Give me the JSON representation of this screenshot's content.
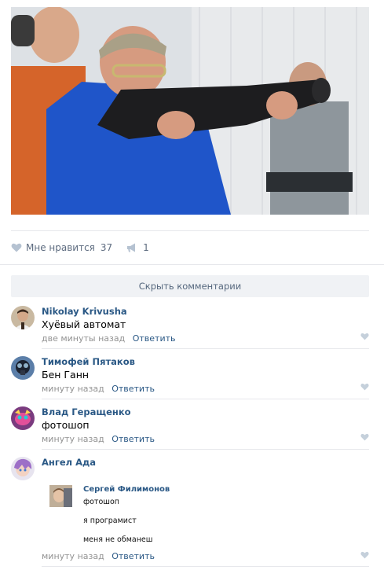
{
  "post": {
    "likes_label": "Мне нравится",
    "likes_count": "37",
    "reposts_count": "1",
    "hide_comments_label": "Скрыть комментарии"
  },
  "comments": [
    {
      "author": "Nikolay Krivusha",
      "text": "Хуёвый автомат",
      "time": "две минуты назад",
      "reply": "Ответить"
    },
    {
      "author": "Тимофей Пятаков",
      "text": "Бен Ганн",
      "time": "минуту назад",
      "reply": "Ответить"
    },
    {
      "author": "Влад Геращенко",
      "text": "фотошоп",
      "time": "минуту назад",
      "reply": "Ответить"
    },
    {
      "author": "Ангел Ада",
      "time": "минуту назад",
      "reply": "Ответить",
      "quoted": {
        "author": "Сергей Филимонов",
        "lines": [
          "фотошоп",
          "я програмист",
          "меня не обманеш"
        ]
      }
    }
  ],
  "colors": {
    "link": "#2a5885",
    "meta": "#939393",
    "separator": "#e7e8ec",
    "button_bg": "#f0f2f5",
    "icon": "#b5c2d1"
  },
  "icons": [
    "heart-icon",
    "megaphone-icon"
  ]
}
